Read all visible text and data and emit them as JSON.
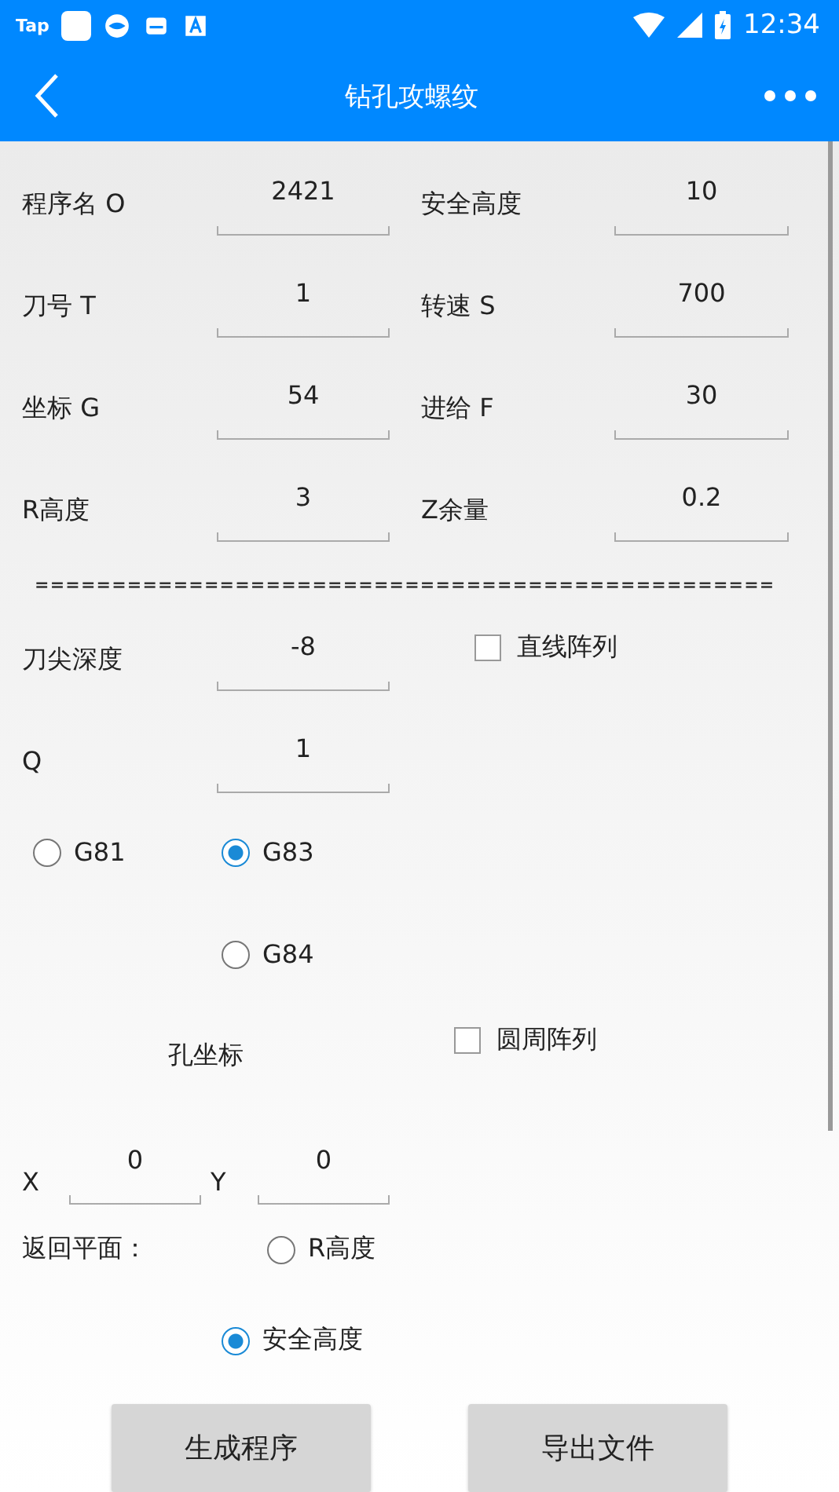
{
  "status_bar": {
    "app_label": "Tap",
    "time": "12:34"
  },
  "app_bar": {
    "title": "钻孔攻螺纹"
  },
  "params": [
    {
      "label": "程序名 O",
      "value": "2421"
    },
    {
      "label": "安全高度",
      "value": "10"
    },
    {
      "label": "刀号 T",
      "value": "1"
    },
    {
      "label": "转速 S",
      "value": "700"
    },
    {
      "label": "坐标 G",
      "value": "54"
    },
    {
      "label": "进给 F",
      "value": "30"
    },
    {
      "label": "R高度",
      "value": "3"
    },
    {
      "label": "Z余量",
      "value": "0.2"
    }
  ],
  "separator": "================================================",
  "depth": {
    "label": "刀尖深度",
    "value": "-8"
  },
  "linear_array": {
    "label": "直线阵列",
    "checked": false
  },
  "q": {
    "label": "Q",
    "value": "1"
  },
  "cycles": [
    {
      "label": "G81",
      "selected": false
    },
    {
      "label": "G83",
      "selected": true
    },
    {
      "label": "G84",
      "selected": false
    }
  ],
  "circular_array": {
    "label": "圆周阵列",
    "checked": false
  },
  "hole_coords": {
    "title": "孔坐标",
    "x_label": "X",
    "x_value": "0",
    "y_label": "Y",
    "y_value": "0"
  },
  "return_plane": {
    "label": "返回平面：",
    "options": [
      {
        "label": "R高度",
        "selected": false
      },
      {
        "label": "安全高度",
        "selected": true
      }
    ]
  },
  "buttons": [
    "生成程序",
    "导出文件"
  ]
}
